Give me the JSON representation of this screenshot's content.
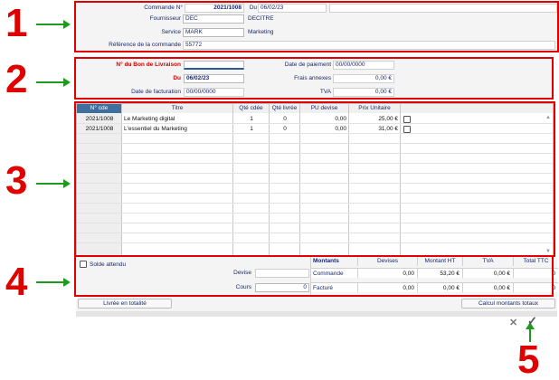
{
  "callouts": [
    "1",
    "2",
    "3",
    "4",
    "5"
  ],
  "header": {
    "commande_label": "Commande N°",
    "commande_value": "2021/1008",
    "date_label": "Du",
    "date_value": "06/02/23",
    "fournisseur_label": "Fournisseur",
    "fournisseur_code": "DEC",
    "fournisseur_name": "DECITRE",
    "service_label": "Service",
    "service_code": "MARK",
    "service_name": "Marketing",
    "reference_label": "Référence de la commande",
    "reference_value": "55772"
  },
  "livraison": {
    "bl_label": "N° du Bon de Livraison",
    "bl_value": "",
    "du_label": "Du",
    "du_value": "06/02/23",
    "facturation_label": "Date de facturation",
    "facturation_value": "00/00/0000",
    "paiement_label": "Date de paiement",
    "paiement_value": "00/00/0000",
    "frais_label": "Frais annexes",
    "frais_value": "0,00 €",
    "tva_label": "TVA",
    "tva_value": "0,00 €"
  },
  "grid": {
    "columns": [
      "N° cde",
      "Titre",
      "Qté cdée",
      "Qté livrée",
      "PU devise",
      "Prix Unitaire"
    ],
    "rows": [
      {
        "cde": "2021/1008",
        "titre": "Le Marketing digital",
        "qte_cdee": "1",
        "qte_livree": "0",
        "pu_devise": "0,00",
        "prix_unitaire": "25,00 €"
      },
      {
        "cde": "2021/1008",
        "titre": "L'essentiel du Marketing",
        "qte_cdee": "1",
        "qte_livree": "0",
        "pu_devise": "0,00",
        "prix_unitaire": "31,00 €"
      }
    ]
  },
  "totals": {
    "solde_label": "Solde attendu",
    "devise_label": "Devise",
    "devise_value": "",
    "cours_label": "Cours",
    "cours_value": "0",
    "livree_button": "Livrée en totalité",
    "calcul_button": "Calcul montants totaux",
    "montants_header": "Montants",
    "columns": [
      "Devises",
      "Montant HT",
      "TVA",
      "Total TTC"
    ],
    "rows": [
      {
        "label": "Commande",
        "devises": "0,00",
        "montant_ht": "53,20 €",
        "tva": "0,00 €",
        "total_ttc": "0"
      },
      {
        "label": "Facturé",
        "devises": "0,00",
        "montant_ht": "0,00 €",
        "tva": "0,00 €",
        "total_ttc": "0"
      }
    ]
  },
  "footer": {
    "cancel_glyph": "✕",
    "confirm_glyph": "✓"
  },
  "colors": {
    "callout": "#e00000",
    "arrow": "#1f9a1f",
    "header_selected": "#3f6f9f"
  }
}
